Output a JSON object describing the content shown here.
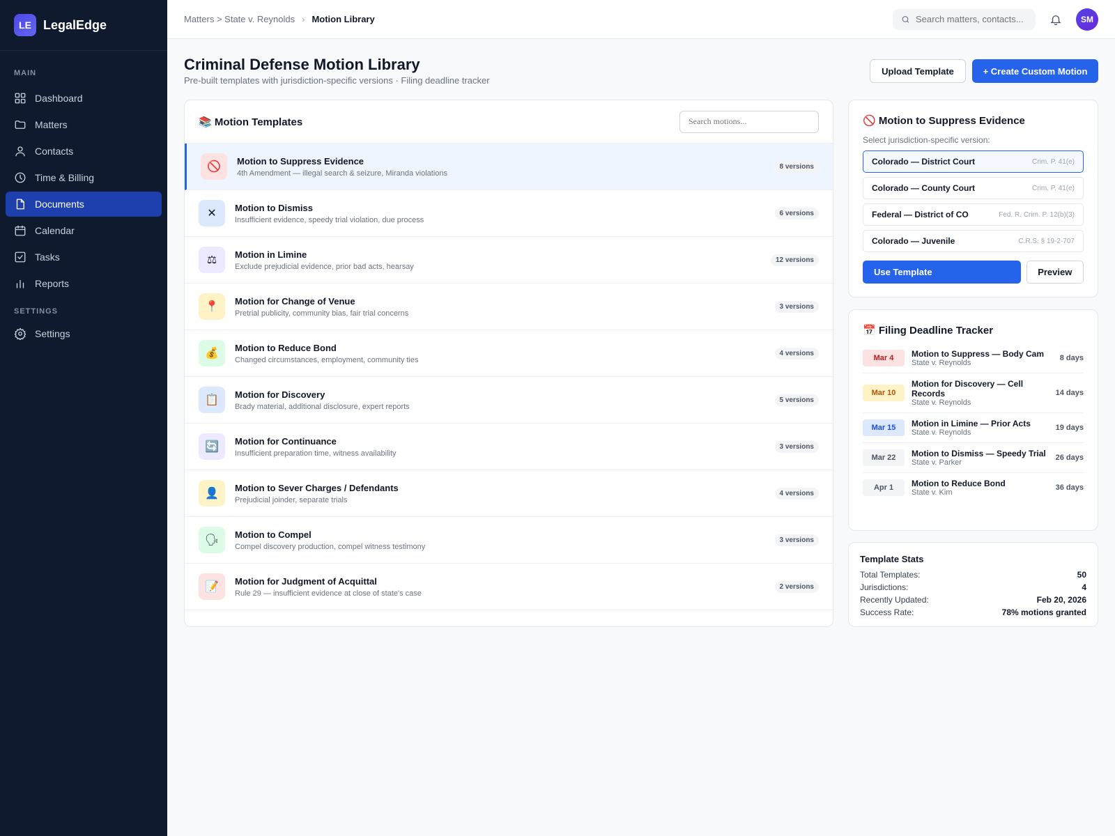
{
  "brand": {
    "initials": "LE",
    "name": "LegalEdge"
  },
  "nav": {
    "main_label": "MAIN",
    "items": [
      {
        "label": "Dashboard",
        "icon": "dashboard-icon"
      },
      {
        "label": "Matters",
        "icon": "folder-icon"
      },
      {
        "label": "Contacts",
        "icon": "user-icon"
      },
      {
        "label": "Time & Billing",
        "icon": "clock-icon"
      },
      {
        "label": "Documents",
        "icon": "document-icon"
      },
      {
        "label": "Calendar",
        "icon": "calendar-icon"
      },
      {
        "label": "Tasks",
        "icon": "checkbox-icon"
      },
      {
        "label": "Reports",
        "icon": "bar-chart-icon"
      }
    ],
    "settings_label": "SETTINGS",
    "settings_item": "Settings"
  },
  "breadcrumb": {
    "parent": "Matters > State v. Reynolds",
    "separator": "›",
    "current": "Motion Library"
  },
  "search": {
    "placeholder": "Search matters, contacts..."
  },
  "user": {
    "initials": "SM"
  },
  "header": {
    "title": "Criminal Defense Motion Library",
    "subtitle": "Pre-built templates with jurisdiction-specific versions · Filing deadline tracker",
    "upload_label": "Upload Template",
    "create_label": "+ Create Custom Motion"
  },
  "templates": {
    "title": "📚 Motion Templates",
    "search_placeholder": "Search motions...",
    "items": [
      {
        "icon": "🚫",
        "name": "Motion to Suppress Evidence",
        "desc": "4th Amendment — illegal search & seizure, Miranda violations",
        "versions": "8 versions",
        "bg": "#fde2e2"
      },
      {
        "icon": "✕",
        "name": "Motion to Dismiss",
        "desc": "Insufficient evidence, speedy trial violation, due process",
        "versions": "6 versions",
        "bg": "#dbe8fe"
      },
      {
        "icon": "⚖",
        "name": "Motion in Limine",
        "desc": "Exclude prejudicial evidence, prior bad acts, hearsay",
        "versions": "12 versions",
        "bg": "#ede9fe"
      },
      {
        "icon": "📍",
        "name": "Motion for Change of Venue",
        "desc": "Pretrial publicity, community bias, fair trial concerns",
        "versions": "3 versions",
        "bg": "#fef3c7"
      },
      {
        "icon": "💰",
        "name": "Motion to Reduce Bond",
        "desc": "Changed circumstances, employment, community ties",
        "versions": "4 versions",
        "bg": "#dcfce7"
      },
      {
        "icon": "📋",
        "name": "Motion for Discovery",
        "desc": "Brady material, additional disclosure, expert reports",
        "versions": "5 versions",
        "bg": "#dbe8fe"
      },
      {
        "icon": "🔄",
        "name": "Motion for Continuance",
        "desc": "Insufficient preparation time, witness availability",
        "versions": "3 versions",
        "bg": "#ede9fe"
      },
      {
        "icon": "👤",
        "name": "Motion to Sever Charges / Defendants",
        "desc": "Prejudicial joinder, separate trials",
        "versions": "4 versions",
        "bg": "#fef3c7"
      },
      {
        "icon": "🗣",
        "name": "Motion to Compel",
        "desc": "Compel discovery production, compel witness testimony",
        "versions": "3 versions",
        "bg": "#dcfce7"
      },
      {
        "icon": "📝",
        "name": "Motion for Judgment of Acquittal",
        "desc": "Rule 29 — insufficient evidence at close of state's case",
        "versions": "2 versions",
        "bg": "#fde2e2"
      }
    ]
  },
  "selected": {
    "title": "🚫 Motion to Suppress Evidence",
    "subtitle": "Select jurisdiction-specific version:",
    "options": [
      {
        "name": "Colorado — District Court",
        "cite": "Crim. P. 41(e)"
      },
      {
        "name": "Colorado — County Court",
        "cite": "Crim. P. 41(e)"
      },
      {
        "name": "Federal — District of CO",
        "cite": "Fed. R. Crim. P. 12(b)(3)"
      },
      {
        "name": "Colorado — Juvenile",
        "cite": "C.R.S. § 19-2-707"
      }
    ],
    "use_label": "Use Template",
    "preview_label": "Preview"
  },
  "deadlines": {
    "title": "📅 Filing Deadline Tracker",
    "items": [
      {
        "date": "Mar 4",
        "name": "Motion to Suppress — Body Cam",
        "case": "State v. Reynolds",
        "days": "8 days",
        "bg": "#fde2e2",
        "fg": "#b91c1c"
      },
      {
        "date": "Mar 10",
        "name": "Motion for Discovery — Cell Records",
        "case": "State v. Reynolds",
        "days": "14 days",
        "bg": "#fef3c7",
        "fg": "#b45309"
      },
      {
        "date": "Mar 15",
        "name": "Motion in Limine — Prior Acts",
        "case": "State v. Reynolds",
        "days": "19 days",
        "bg": "#dbe8fe",
        "fg": "#1d4ed8"
      },
      {
        "date": "Mar 22",
        "name": "Motion to Dismiss — Speedy Trial",
        "case": "State v. Parker",
        "days": "26 days",
        "bg": "#f3f4f6",
        "fg": "#4b5563"
      },
      {
        "date": "Apr 1",
        "name": "Motion to Reduce Bond",
        "case": "State v. Kim",
        "days": "36 days",
        "bg": "#f3f4f6",
        "fg": "#4b5563"
      }
    ]
  },
  "stats": {
    "title": "Template Stats",
    "rows": [
      {
        "label": "Total Templates:",
        "value": "50"
      },
      {
        "label": "Jurisdictions:",
        "value": "4"
      },
      {
        "label": "Recently Updated:",
        "value": "Feb 20, 2026"
      },
      {
        "label": "Success Rate:",
        "value": "78% motions granted"
      }
    ]
  }
}
